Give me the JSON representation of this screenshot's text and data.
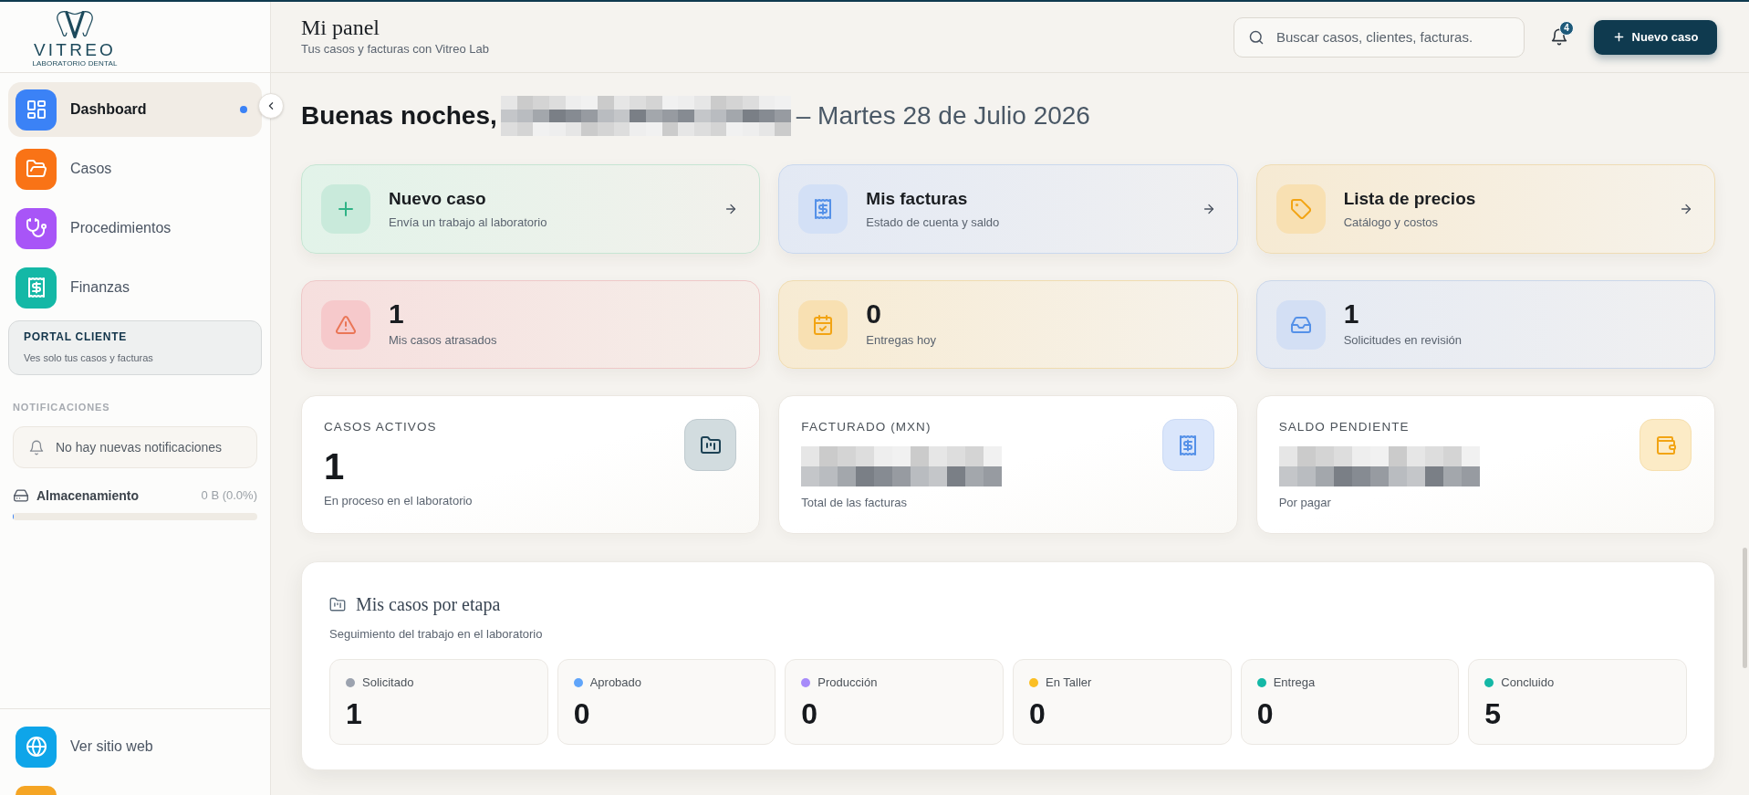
{
  "sidebar": {
    "logo": {
      "wordmark": "VITREO",
      "tagline": "LABORATORIO DENTAL"
    },
    "nav_items": [
      {
        "label": "Dashboard",
        "selected": true
      },
      {
        "label": "Casos",
        "selected": false
      },
      {
        "label": "Procedimientos",
        "selected": false
      },
      {
        "label": "Finanzas",
        "selected": false
      }
    ],
    "portal_note": {
      "title": "PORTAL CLIENTE",
      "text": "Ves solo tus casos y facturas"
    },
    "notifications": {
      "heading": "NOTIFICACIONES",
      "empty_message": "No hay nuevas notificaciones"
    },
    "storage": {
      "label": "Almacenamiento",
      "reading": "0 B (0.0%)",
      "level": 0
    },
    "footer_items": [
      {
        "label": "Ver sitio web"
      }
    ]
  },
  "header": {
    "title": "Mi panel",
    "subtitle": "Tus casos y facturas con Vitreo Lab",
    "search": {
      "placeholder": "Buscar casos, clientes, facturas."
    },
    "notification_count": "4",
    "new_case_button": "Nuevo caso"
  },
  "greeting": {
    "salutation": "Buenas noches,",
    "name_redacted": true,
    "date": "– Martes 28 de Julio 2026"
  },
  "quick_actions": [
    {
      "title": "Nuevo caso",
      "subtitle": "Envía un trabajo al laboratorio"
    },
    {
      "title": "Mis facturas",
      "subtitle": "Estado de cuenta y saldo"
    },
    {
      "title": "Lista de precios",
      "subtitle": "Catálogo y costos"
    }
  ],
  "alerts": [
    {
      "value": "1",
      "label": "Mis casos atrasados"
    },
    {
      "value": "0",
      "label": "Entregas hoy"
    },
    {
      "value": "1",
      "label": "Solicitudes en revisión"
    }
  ],
  "stats": [
    {
      "label": "CASOS ACTIVOS",
      "value": "1",
      "value_redacted": false,
      "subtitle": "En proceso en el laboratorio"
    },
    {
      "label": "FACTURADO (MXN)",
      "value_redacted": true,
      "subtitle": "Total de las facturas"
    },
    {
      "label": "SALDO PENDIENTE",
      "value_redacted": true,
      "subtitle": "Por pagar"
    }
  ],
  "stages_panel": {
    "title": "Mis casos por etapa",
    "subtitle": "Seguimiento del trabajo en el laboratorio",
    "stages": [
      {
        "label": "Solicitado",
        "count": "1",
        "color": "#9ca3af"
      },
      {
        "label": "Aprobado",
        "count": "0",
        "color": "#60a5fa"
      },
      {
        "label": "Producción",
        "count": "0",
        "color": "#a78bfa"
      },
      {
        "label": "En Taller",
        "count": "0",
        "color": "#fbbf24"
      },
      {
        "label": "Entrega",
        "count": "0",
        "color": "#14b8a6"
      },
      {
        "label": "Concluido",
        "count": "5",
        "color": "#14b8a6"
      }
    ]
  }
}
